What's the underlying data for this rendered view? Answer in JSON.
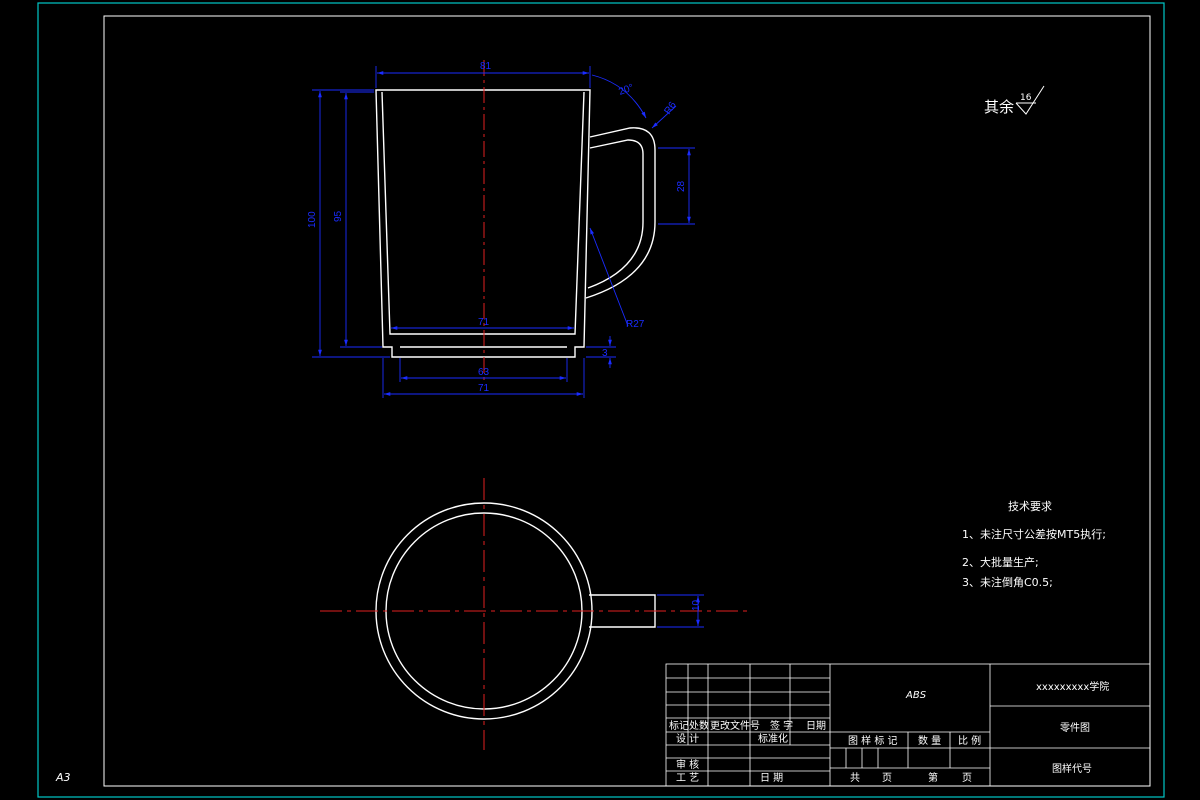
{
  "colors": {
    "background": "#000000",
    "frame": "#00c8c8",
    "outline": "#ffffff",
    "dimension": "#1a2cff",
    "centerline": "#e02020",
    "highlight": "#33ff33"
  },
  "sheet_size": "A3",
  "roughness": {
    "label": "其余",
    "value": "16"
  },
  "tech_requirements": {
    "title": "技术要求",
    "items": [
      "1、未注尺寸公差按MT5执行;",
      "2、大批量生产;",
      "3、未注倒角C0.5;"
    ]
  },
  "dimensions": {
    "top_width": "81",
    "angle": "20°",
    "handle_radius_top": "R6",
    "handle_height": "28",
    "handle_radius_bottom": "R27",
    "total_height": "100",
    "inner_height": "95",
    "bottom_inner_width": "71",
    "base_height": "3",
    "base_inner_width": "63",
    "base_width": "71",
    "handle_thickness": "10"
  },
  "title_block": {
    "material": "ABS",
    "school": "xxxxxxxxx学院",
    "drawing_name": "零件图",
    "drawing_code": "图样代号",
    "rev_headers": [
      "标记",
      "处数",
      "更改文件号",
      "签 字",
      "日期"
    ],
    "row_labels": {
      "design": "设 计",
      "standardize": "标准化",
      "review": "审 核",
      "process": "工 艺",
      "date": "日 期"
    },
    "mid_headers": {
      "mark": "图 样 标 记",
      "qty": "数 量",
      "scale": "比 例"
    },
    "bottom": {
      "total": "共",
      "sheet_unit1": "页",
      "nth": "第",
      "sheet_unit2": "页"
    }
  }
}
